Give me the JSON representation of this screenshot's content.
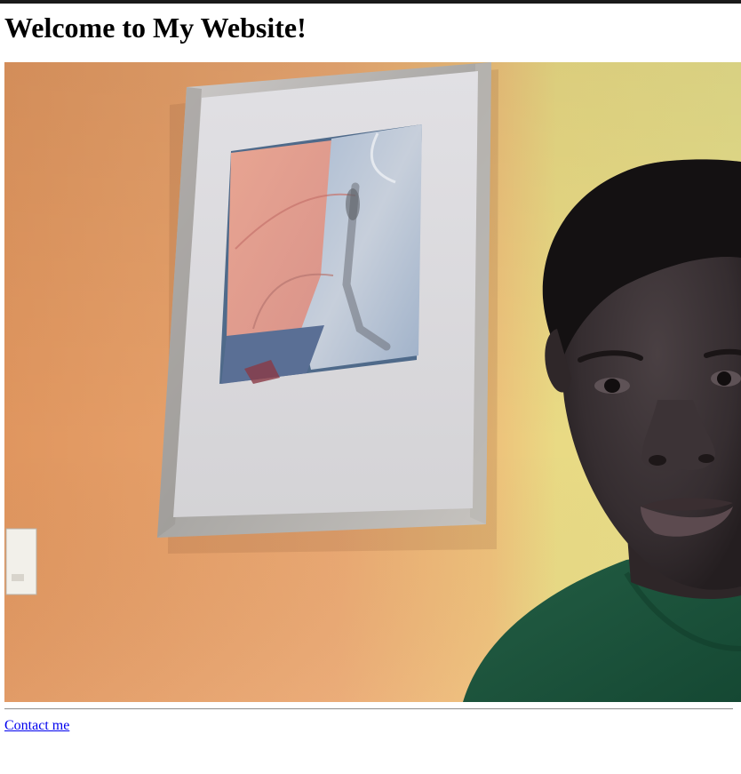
{
  "page": {
    "title": "Welcome to My Website!",
    "contact_link_label": "Contact me"
  },
  "photo": {
    "subject": "portrait-photo",
    "colors": {
      "wall_left": "#e6a36e",
      "wall_right": "#e8dd85",
      "frame": "#b8b6b2",
      "mat": "#d9d9dc",
      "shirt": "#1c5a42",
      "skin": "#3a3234"
    }
  }
}
